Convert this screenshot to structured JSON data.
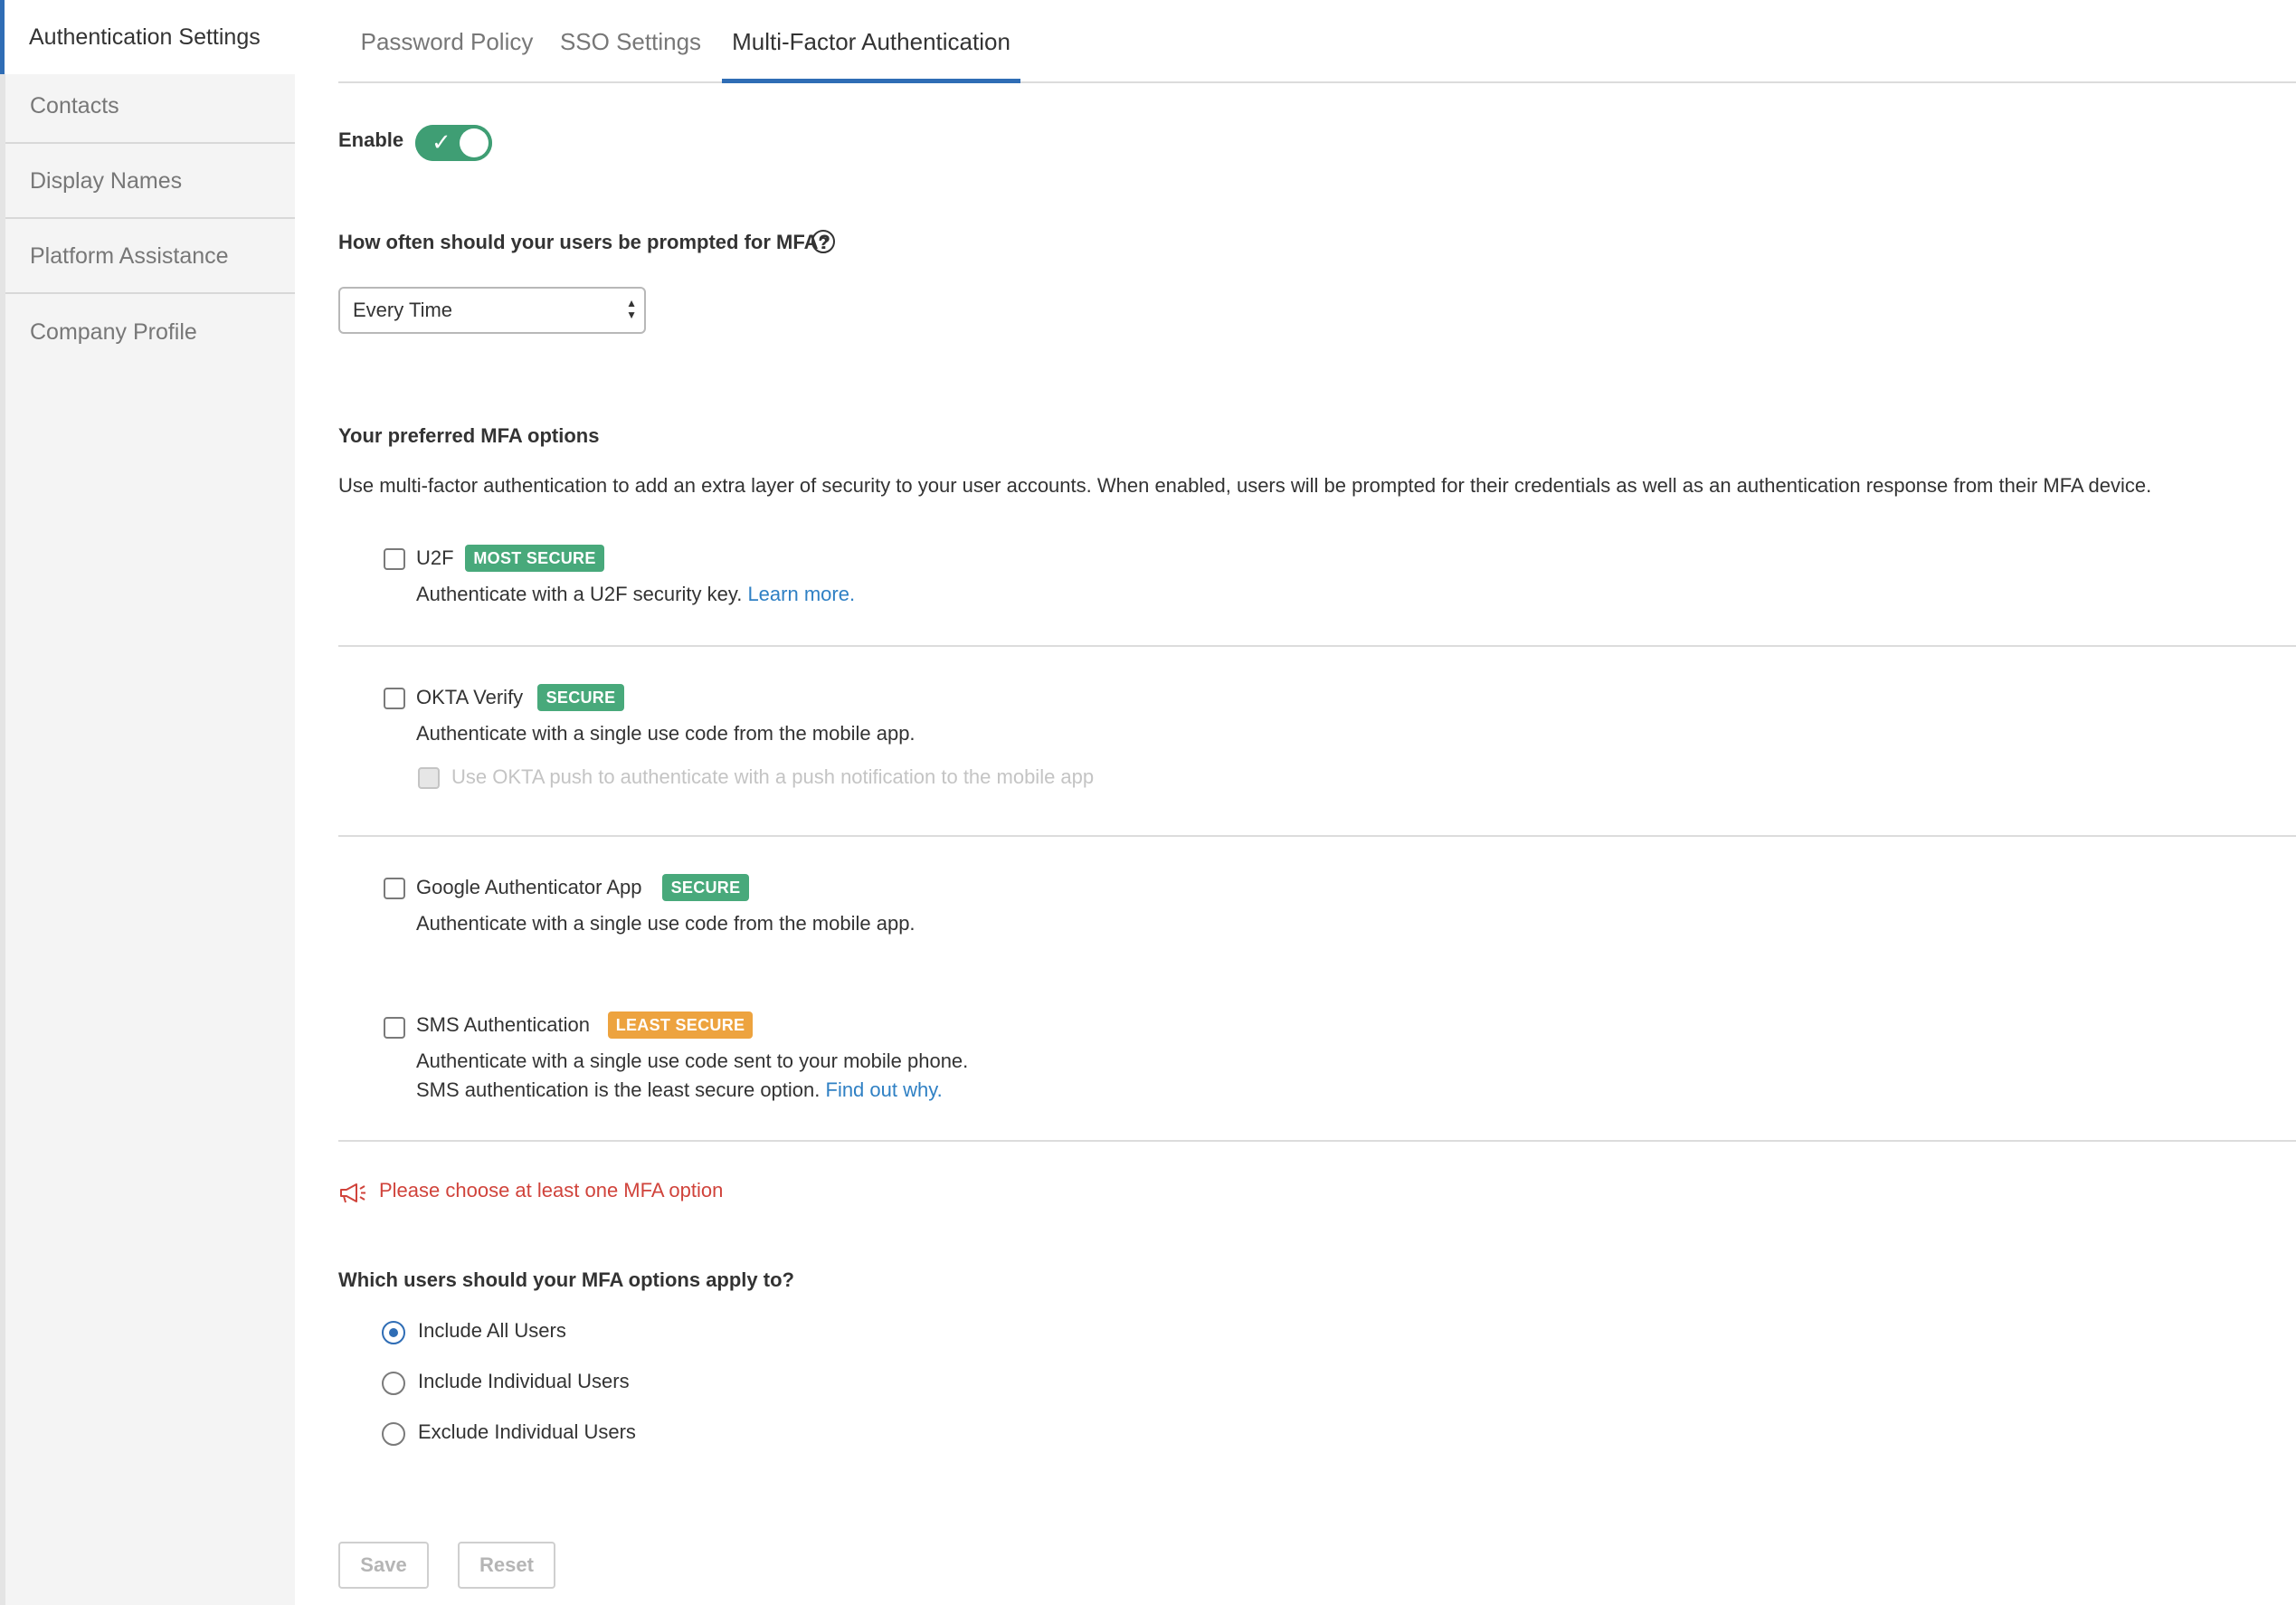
{
  "sidebar": {
    "items": [
      {
        "label": "Authentication Settings",
        "active": true
      },
      {
        "label": "Contacts"
      },
      {
        "label": "Display Names"
      },
      {
        "label": "Platform Assistance"
      },
      {
        "label": "Company Profile"
      }
    ]
  },
  "tabs": [
    {
      "label": "Password Policy"
    },
    {
      "label": "SSO Settings"
    },
    {
      "label": "Multi-Factor Authentication",
      "active": true
    }
  ],
  "enable": {
    "label": "Enable",
    "on": true,
    "check_glyph": "✓"
  },
  "frequency": {
    "question": "How often should your users be prompted for MFA?",
    "help_glyph": "?",
    "selected": "Every Time"
  },
  "mfa_options": {
    "heading": "Your preferred MFA options",
    "description": "Use multi-factor authentication to add an extra layer of security to your user accounts. When enabled, users will be prompted for their credentials as well as an authentication response from their MFA device.",
    "u2f": {
      "title": "U2F",
      "badge": "MOST SECURE",
      "desc": "Authenticate with a U2F security key.",
      "link": "Learn more."
    },
    "okta": {
      "title": "OKTA Verify",
      "badge": "SECURE",
      "desc": "Authenticate with a single use code from the mobile app.",
      "push": "Use OKTA push to authenticate with a push notification to the mobile app"
    },
    "google": {
      "title": "Google Authenticator App",
      "badge": "SECURE",
      "desc": "Authenticate with a single use code from the mobile app."
    },
    "sms": {
      "title": "SMS Authentication",
      "badge": "LEAST SECURE",
      "desc1": "Authenticate with a single use code sent to your mobile phone.",
      "desc2": "SMS authentication is the least secure option.",
      "link": "Find out why."
    }
  },
  "warning": {
    "text": "Please choose at least one MFA option",
    "icon": "megaphone-icon",
    "color": "#d0433b"
  },
  "apply": {
    "question": "Which users should your MFA options apply to?",
    "options": [
      {
        "label": "Include All Users",
        "checked": true
      },
      {
        "label": "Include Individual Users",
        "checked": false
      },
      {
        "label": "Exclude Individual Users",
        "checked": false
      }
    ]
  },
  "actions": {
    "save": "Save",
    "reset": "Reset"
  },
  "colors": {
    "accent": "#2f6db5",
    "toggle": "#3f9e74",
    "badge_green": "#48a97b",
    "badge_orange": "#eda33f",
    "link": "#2f80c4"
  }
}
